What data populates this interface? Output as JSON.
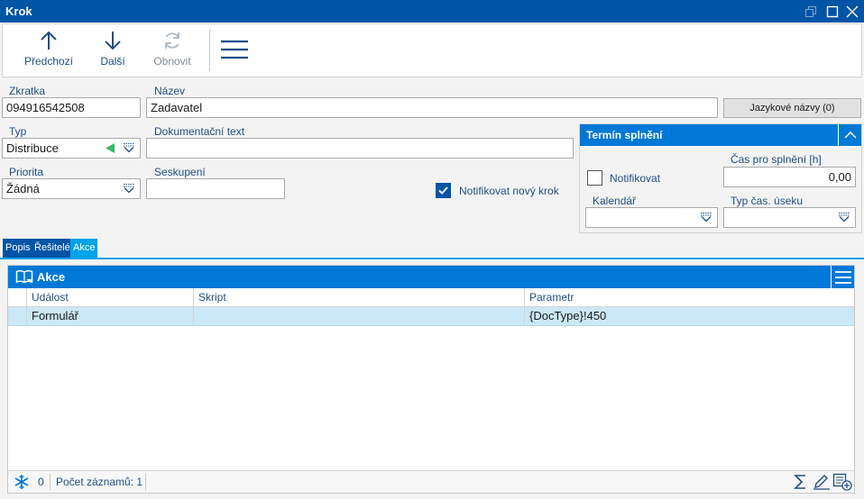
{
  "window": {
    "title": "Krok",
    "controls": [
      "restore-icon",
      "maximize-icon",
      "close-icon"
    ]
  },
  "toolbar": {
    "prev_label": "Předchozí",
    "next_label": "Další",
    "refresh_label": "Obnovit",
    "menu_icon": "hamburger-icon"
  },
  "form": {
    "zkratka_label": "Zkratka",
    "zkratka_value": "094916542508",
    "nazev_label": "Název",
    "nazev_value": "Zadavatel",
    "lang_button": "Jazykové názvy (0)",
    "typ_label": "Typ",
    "typ_value": "Distribuce",
    "doc_label": "Dokumentační text",
    "doc_value": "",
    "priorita_label": "Priorita",
    "priorita_value": "Žádná",
    "seskupeni_label": "Seskupení",
    "seskupeni_value": "",
    "notify_new_label": "Notifikovat nový krok",
    "notify_new_checked": true
  },
  "termin": {
    "title": "Termín splnění",
    "notify_label": "Notifikovat",
    "notify_checked": false,
    "cas_label": "Čas pro splnění [h]",
    "cas_value": "0,00",
    "kalendar_label": "Kalendář",
    "kalendar_value": "",
    "typ_cas_label": "Typ čas. úseku",
    "typ_cas_value": ""
  },
  "tabs": [
    {
      "label": "Popis",
      "active": false
    },
    {
      "label": "Řešitelé",
      "active": false
    },
    {
      "label": "Akce",
      "active": true
    }
  ],
  "akce": {
    "title": "Akce",
    "columns": [
      "Událost",
      "Skript",
      "Parametr"
    ],
    "rows": [
      {
        "udalost": "Formulář",
        "skript": "",
        "parametr": "{DocType}!450"
      }
    ],
    "status_count": "0",
    "status_records": "Počet záznamů: 1"
  },
  "colors": {
    "titlebar": "#0054a6",
    "header_blue": "#0078d7",
    "tab_active": "#00a2e8",
    "selected_row": "#cbe8f6",
    "green_arrow": "#3cb371"
  }
}
